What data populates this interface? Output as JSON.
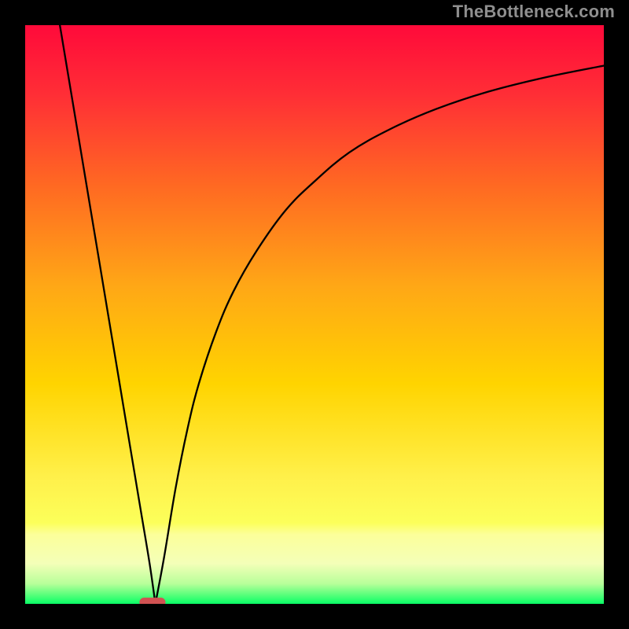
{
  "watermark": {
    "text": "TheBottleneck.com"
  },
  "chart_data": {
    "type": "line",
    "title": "",
    "xlabel": "",
    "ylabel": "",
    "xlim": [
      0,
      100
    ],
    "ylim": [
      0,
      100
    ],
    "grid": false,
    "legend": false,
    "annotations": [],
    "background_gradient": {
      "top": "#ff0a3a",
      "mid_upper": "#ff7a1a",
      "mid": "#ffd400",
      "mid_lower": "#fff04a",
      "band": "#fcff9a",
      "bottom": "#09ff66"
    },
    "marker": {
      "shape": "rounded-rect",
      "fill": "#d15252",
      "x": 22,
      "y": 0,
      "width_pct": 4.5,
      "height_pct": 1.6
    },
    "series": [
      {
        "name": "left-branch",
        "x": [
          6,
          8,
          10,
          12,
          14,
          16,
          18,
          20,
          21.5,
          22.5
        ],
        "y": [
          100,
          88,
          76,
          64,
          52,
          40,
          28,
          16,
          7,
          0
        ]
      },
      {
        "name": "right-branch",
        "x": [
          22.5,
          24,
          26,
          28,
          30,
          33,
          36,
          40,
          45,
          50,
          56,
          63,
          71,
          80,
          90,
          100
        ],
        "y": [
          0,
          8,
          20,
          30,
          38,
          47,
          54,
          61,
          68,
          73,
          78,
          82,
          85.5,
          88.5,
          91,
          93
        ]
      }
    ]
  }
}
